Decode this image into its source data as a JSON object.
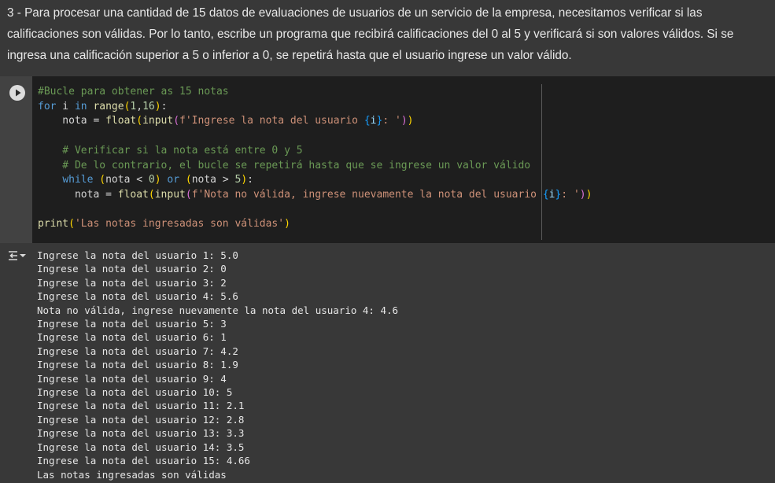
{
  "text_cell": {
    "text": "3 - Para procesar una cantidad de 15 datos de evaluaciones de usuarios de un servicio de la empresa, necesitamos verificar si las calificaciones son válidas. Por lo tanto, escribe un programa que recibirá calificaciones del 0 al 5 y verificará si son valores válidos. Si se ingresa una calificación superior a 5 o inferior a 0, se repetirá hasta que el usuario ingrese un valor válido."
  },
  "code_cell": {
    "run_icon": "play-icon",
    "lines": [
      "#Bucle para obtener as 15 notas",
      "for i in range(1,16):",
      "    nota = float(input(f'Ingrese la nota del usuario {i}: '))",
      "",
      "    # Verificar si la nota está entre 0 y 5",
      "    # De lo contrario, el bucle se repetirá hasta que se ingrese un valor válido",
      "    while (nota < 0) or (nota > 5):",
      "      nota = float(input(f'Nota no válida, ingrese nuevamente la nota del usuario {i}: '))",
      "",
      "print('Las notas ingresadas son válidas')"
    ]
  },
  "output": {
    "icon": "output-toggle-icon",
    "lines": [
      "Ingrese la nota del usuario 1: 5.0",
      "Ingrese la nota del usuario 2: 0",
      "Ingrese la nota del usuario 3: 2",
      "Ingrese la nota del usuario 4: 5.6",
      "Nota no válida, ingrese nuevamente la nota del usuario 4: 4.6",
      "Ingrese la nota del usuario 5: 3",
      "Ingrese la nota del usuario 6: 1",
      "Ingrese la nota del usuario 7: 4.2",
      "Ingrese la nota del usuario 8: 1.9",
      "Ingrese la nota del usuario 9: 4",
      "Ingrese la nota del usuario 10: 5",
      "Ingrese la nota del usuario 11: 2.1",
      "Ingrese la nota del usuario 12: 2.8",
      "Ingrese la nota del usuario 13: 3.3",
      "Ingrese la nota del usuario 14: 3.5",
      "Ingrese la nota del usuario 15: 4.66",
      "Las notas ingresadas son válidas"
    ]
  },
  "colors": {
    "background": "#383838",
    "editor": "#1e1e1e",
    "keyword": "#569cd6",
    "function": "#dcdcaa",
    "comment": "#6a9955",
    "string": "#ce9178",
    "number": "#b5cea8"
  }
}
